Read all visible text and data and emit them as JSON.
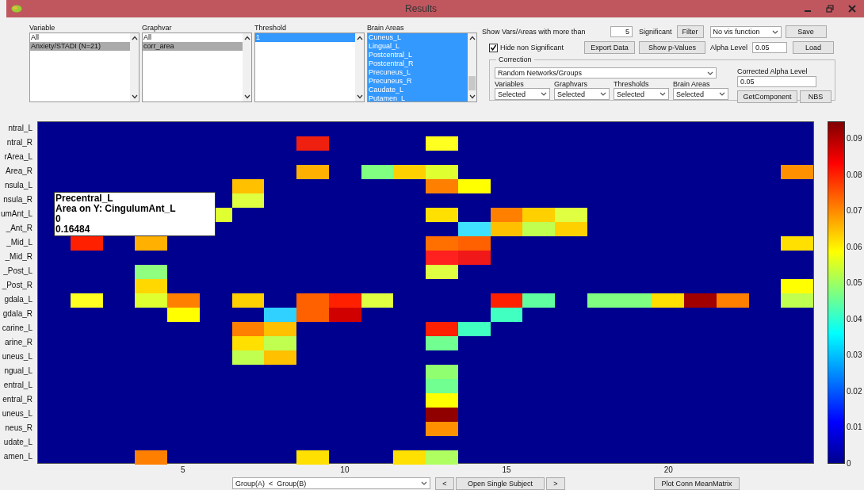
{
  "window": {
    "title": "Results"
  },
  "lists": [
    {
      "label": "Variable",
      "focused": false,
      "scrollbar": false,
      "items": [
        {
          "label": "All",
          "selected": false
        },
        {
          "label": "Anxiety/STADI (N=21)",
          "selected": true
        }
      ]
    },
    {
      "label": "Graphvar",
      "focused": false,
      "scrollbar": false,
      "items": [
        {
          "label": "All",
          "selected": false
        },
        {
          "label": "corr_area",
          "selected": true
        }
      ]
    },
    {
      "label": "Threshold",
      "focused": true,
      "scrollbar": false,
      "items": [
        {
          "label": "1",
          "selected": true
        }
      ]
    },
    {
      "label": "Brain Areas",
      "focused": true,
      "scrollbar": true,
      "items": [
        {
          "label": "Cuneus_L",
          "selected": true
        },
        {
          "label": "Lingual_L",
          "selected": true
        },
        {
          "label": "Postcentral_L",
          "selected": true
        },
        {
          "label": "Postcentral_R",
          "selected": true
        },
        {
          "label": "Precuneus_L",
          "selected": true
        },
        {
          "label": "Precuneus_R",
          "selected": true
        },
        {
          "label": "Caudate_L",
          "selected": true
        },
        {
          "label": "Putamen_L",
          "selected": true
        }
      ]
    }
  ],
  "filter": {
    "label": "Show Vars/Areas with more than",
    "value": "5",
    "suffix": "Significant",
    "button": "Filter"
  },
  "vis_function": "No vis function",
  "save": "Save",
  "load": "Load",
  "hide_non_significant": {
    "label": "Hide non Significant",
    "checked": true
  },
  "export": "Export Data",
  "show_p_values": "Show p-Values",
  "alpha": {
    "label": "Alpha Level",
    "value": "0.05"
  },
  "correction": {
    "title": "Correction",
    "method": "Random Networks/Groups",
    "corrected_alpha": {
      "label": "Corrected Alpha Level",
      "value": "0.05"
    },
    "selects": [
      {
        "label": "Variables",
        "value": "Selected"
      },
      {
        "label": "Graphvars",
        "value": "Selected"
      },
      {
        "label": "Thresholds",
        "value": "Selected"
      },
      {
        "label": "Brain Areas",
        "value": "Selected"
      }
    ],
    "buttons": [
      "GetComponent",
      "NBS"
    ]
  },
  "heatmap": {
    "rows": [
      {
        "label": "ntral_L",
        "cells": [
          null,
          null,
          null,
          null,
          null,
          null,
          null,
          null,
          null,
          null,
          null,
          null,
          null,
          null,
          null,
          null,
          null,
          null,
          null,
          null,
          null,
          null,
          null,
          null
        ]
      },
      {
        "label": "ntral_R",
        "cells": [
          null,
          null,
          null,
          null,
          null,
          null,
          null,
          null,
          {
            "color": "#f02010"
          },
          null,
          null,
          null,
          {
            "color": "#ffff20"
          },
          null,
          null,
          null,
          null,
          null,
          null,
          null,
          null,
          null,
          null,
          null
        ]
      },
      {
        "label": "rArea_L",
        "cells": [
          null,
          null,
          null,
          null,
          null,
          null,
          null,
          null,
          null,
          null,
          null,
          null,
          null,
          null,
          null,
          null,
          null,
          null,
          null,
          null,
          null,
          null,
          null,
          null
        ]
      },
      {
        "label": "Area_R",
        "cells": [
          null,
          null,
          null,
          null,
          null,
          null,
          null,
          null,
          {
            "color": "#ffb000"
          },
          null,
          {
            "color": "#80ff80"
          },
          {
            "color": "#ffd000"
          },
          {
            "color": "#e0ff30"
          },
          null,
          null,
          null,
          null,
          null,
          null,
          null,
          null,
          null,
          null,
          {
            "color": "#ff9000"
          }
        ]
      },
      {
        "label": "nsula_L",
        "cells": [
          null,
          null,
          null,
          null,
          null,
          null,
          {
            "color": "#ffc000"
          },
          null,
          null,
          null,
          null,
          null,
          {
            "color": "#ff8000"
          },
          {
            "color": "#ffff00"
          },
          null,
          null,
          null,
          null,
          null,
          null,
          null,
          null,
          null,
          null
        ]
      },
      {
        "label": "nsula_R",
        "cells": [
          null,
          null,
          null,
          null,
          null,
          null,
          {
            "color": "#e0ff40"
          },
          null,
          null,
          null,
          null,
          null,
          null,
          null,
          null,
          null,
          null,
          null,
          null,
          null,
          null,
          null,
          null,
          null
        ]
      },
      {
        "label": "umAnt_L",
        "cells": [
          null,
          null,
          null,
          null,
          null,
          {
            "color": "#e0ff30"
          },
          null,
          null,
          null,
          null,
          null,
          null,
          {
            "color": "#ffe000"
          },
          null,
          {
            "color": "#ff8000"
          },
          {
            "color": "#ffd000"
          },
          {
            "color": "#e0ff40"
          },
          null,
          null,
          null,
          null,
          null,
          null,
          null
        ]
      },
      {
        "label": "_Ant_R",
        "cells": [
          null,
          null,
          null,
          null,
          null,
          null,
          null,
          null,
          null,
          null,
          null,
          null,
          null,
          {
            "color": "#40e0ff"
          },
          {
            "color": "#ffc000"
          },
          {
            "color": "#c0ff50"
          },
          {
            "color": "#ffd000"
          },
          null,
          null,
          null,
          null,
          null,
          null,
          null
        ]
      },
      {
        "label": "_Mid_L",
        "cells": [
          null,
          {
            "color": "#ff2000"
          },
          null,
          {
            "color": "#ffb000"
          },
          null,
          null,
          null,
          null,
          null,
          null,
          null,
          null,
          {
            "color": "#ff7000"
          },
          {
            "color": "#ff6000"
          },
          null,
          null,
          null,
          null,
          null,
          null,
          null,
          null,
          null,
          {
            "color": "#ffe000"
          }
        ]
      },
      {
        "label": "_Mid_R",
        "cells": [
          null,
          null,
          null,
          null,
          null,
          null,
          null,
          null,
          null,
          null,
          null,
          null,
          {
            "color": "#ff2020"
          },
          {
            "color": "#f01818"
          },
          null,
          null,
          null,
          null,
          null,
          null,
          null,
          null,
          null,
          null
        ]
      },
      {
        "label": "_Post_L",
        "cells": [
          null,
          null,
          null,
          {
            "color": "#90ff80"
          },
          null,
          null,
          null,
          null,
          null,
          null,
          null,
          null,
          {
            "color": "#e0ff40"
          },
          null,
          null,
          null,
          null,
          null,
          null,
          null,
          null,
          null,
          null,
          null
        ]
      },
      {
        "label": "_Post_R",
        "cells": [
          null,
          null,
          null,
          {
            "color": "#ffd800"
          },
          null,
          null,
          null,
          null,
          null,
          null,
          null,
          null,
          null,
          null,
          null,
          null,
          null,
          null,
          null,
          null,
          null,
          null,
          null,
          {
            "color": "#ffff00"
          }
        ]
      },
      {
        "label": "gdala_L",
        "cells": [
          null,
          {
            "color": "#ffff20"
          },
          null,
          {
            "color": "#e0ff30"
          },
          {
            "color": "#ff8000"
          },
          null,
          {
            "color": "#ffd000"
          },
          null,
          {
            "color": "#ff6000"
          },
          {
            "color": "#ff2000"
          },
          {
            "color": "#e0ff40"
          },
          null,
          null,
          null,
          {
            "color": "#ff2000"
          },
          {
            "color": "#60ffa0"
          },
          null,
          {
            "color": "#80ff80"
          },
          {
            "color": "#80ff80"
          },
          {
            "color": "#ffe000"
          },
          {
            "color": "#a00000"
          },
          {
            "color": "#ff8000"
          },
          null,
          {
            "color": "#c0ff50"
          }
        ]
      },
      {
        "label": "gdala_R",
        "cells": [
          null,
          null,
          null,
          null,
          {
            "color": "#ffff00"
          },
          null,
          null,
          {
            "color": "#30d0ff"
          },
          {
            "color": "#ff6000"
          },
          {
            "color": "#d00000"
          },
          null,
          null,
          null,
          null,
          {
            "color": "#40ffc0"
          },
          null,
          null,
          null,
          null,
          null,
          null,
          null,
          null,
          null
        ]
      },
      {
        "label": "carine_L",
        "cells": [
          null,
          null,
          null,
          null,
          null,
          null,
          {
            "color": "#ff8000"
          },
          {
            "color": "#ffc000"
          },
          null,
          null,
          null,
          null,
          {
            "color": "#ff2000"
          },
          {
            "color": "#40ffc0"
          },
          null,
          null,
          null,
          null,
          null,
          null,
          null,
          null,
          null,
          null
        ]
      },
      {
        "label": "arine_R",
        "cells": [
          null,
          null,
          null,
          null,
          null,
          null,
          {
            "color": "#ffe000"
          },
          {
            "color": "#c0ff50"
          },
          null,
          null,
          null,
          null,
          {
            "color": "#70ff90"
          },
          null,
          null,
          null,
          null,
          null,
          null,
          null,
          null,
          null,
          null,
          null
        ]
      },
      {
        "label": "uneus_L",
        "cells": [
          null,
          null,
          null,
          null,
          null,
          null,
          {
            "color": "#c0ff50"
          },
          {
            "color": "#ffc000"
          },
          null,
          null,
          null,
          null,
          null,
          null,
          null,
          null,
          null,
          null,
          null,
          null,
          null,
          null,
          null,
          null
        ]
      },
      {
        "label": "ngual_L",
        "cells": [
          null,
          null,
          null,
          null,
          null,
          null,
          null,
          null,
          null,
          null,
          null,
          null,
          {
            "color": "#90ff70"
          },
          null,
          null,
          null,
          null,
          null,
          null,
          null,
          null,
          null,
          null,
          null
        ]
      },
      {
        "label": "entral_L",
        "cells": [
          null,
          null,
          null,
          null,
          null,
          null,
          null,
          null,
          null,
          null,
          null,
          null,
          {
            "color": "#70ff90"
          },
          null,
          null,
          null,
          null,
          null,
          null,
          null,
          null,
          null,
          null,
          null
        ]
      },
      {
        "label": "entral_R",
        "cells": [
          null,
          null,
          null,
          null,
          null,
          null,
          null,
          null,
          null,
          null,
          null,
          null,
          {
            "color": "#ffff00"
          },
          null,
          null,
          null,
          null,
          null,
          null,
          null,
          null,
          null,
          null,
          null
        ]
      },
      {
        "label": "uneus_L",
        "cells": [
          null,
          null,
          null,
          null,
          null,
          null,
          null,
          null,
          null,
          null,
          null,
          null,
          {
            "color": "#900000"
          },
          null,
          null,
          null,
          null,
          null,
          null,
          null,
          null,
          null,
          null,
          null
        ]
      },
      {
        "label": "neus_R",
        "cells": [
          null,
          null,
          null,
          null,
          null,
          null,
          null,
          null,
          null,
          null,
          null,
          null,
          {
            "color": "#ff9000"
          },
          null,
          null,
          null,
          null,
          null,
          null,
          null,
          null,
          null,
          null,
          null
        ]
      },
      {
        "label": "udate_L",
        "cells": [
          null,
          null,
          null,
          null,
          null,
          null,
          null,
          null,
          null,
          null,
          null,
          null,
          null,
          null,
          null,
          null,
          null,
          null,
          null,
          null,
          null,
          null,
          null,
          null
        ]
      },
      {
        "label": "amen_L",
        "cells": [
          null,
          null,
          null,
          {
            "color": "#ff8000"
          },
          null,
          null,
          null,
          null,
          {
            "color": "#ffe000"
          },
          null,
          null,
          {
            "color": "#ffe000"
          },
          {
            "color": "#b0ff60"
          },
          null,
          null,
          null,
          null,
          null,
          null,
          null,
          null,
          null,
          null,
          null
        ]
      }
    ],
    "xticks": [
      "5",
      "10",
      "15",
      "20"
    ],
    "tooltip": [
      "Precentral_L",
      "Area on Y: CingulumAnt_L",
      "0",
      "0.16484"
    ]
  },
  "colorbar": {
    "ticks": [
      "0.09",
      "0.08",
      "0.07",
      "0.06",
      "0.05",
      "0.04",
      "0.03",
      "0.02",
      "0.01",
      "0"
    ]
  },
  "bottom": {
    "comparison": "Group(A)  <  Group(B)",
    "previous": "<",
    "open_subject": "Open Single Subject",
    "next": ">",
    "plot": "Plot Conn MeanMatrix"
  }
}
